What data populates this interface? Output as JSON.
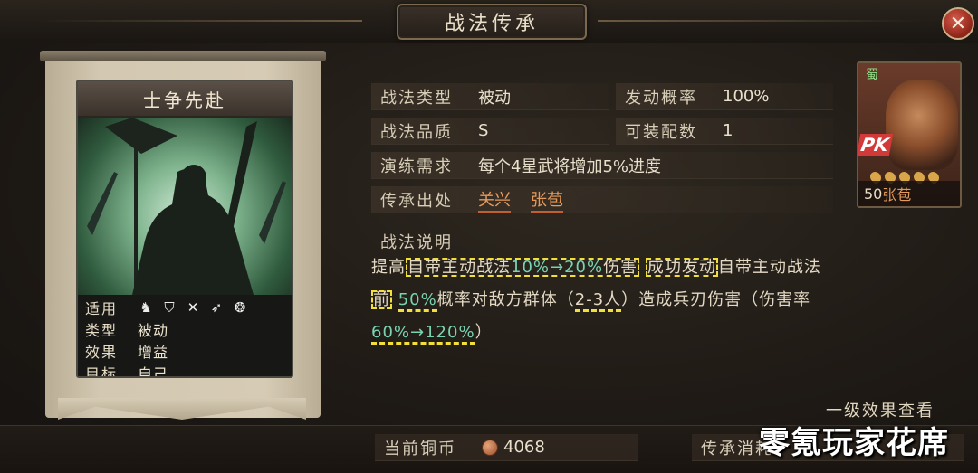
{
  "window": {
    "title": "战法传承",
    "close_label": "✕"
  },
  "card": {
    "name": "士争先赴",
    "stats": [
      {
        "label": "适用",
        "value": ""
      },
      {
        "label": "类型",
        "value": "被动"
      },
      {
        "label": "效果",
        "value": "增益"
      },
      {
        "label": "目标",
        "value": "自己"
      }
    ],
    "troop_icons": [
      "cavalry-icon",
      "shield-icon",
      "bow-icon",
      "spear-icon",
      "wheel-icon"
    ]
  },
  "info": {
    "type_label": "战法类型",
    "type_value": "被动",
    "rate_label": "发动概率",
    "rate_value": "100%",
    "quality_label": "战法品质",
    "quality_value": "S",
    "equip_label": "可装配数",
    "equip_value": "1",
    "practice_label": "演练需求",
    "practice_value": "每个4星武将增加5%进度",
    "source_label": "传承出处",
    "source_1": "关兴",
    "source_2": "张苞"
  },
  "description": {
    "title": "战法说明",
    "l1_a": "提高",
    "l1_b": "自带主动战法",
    "l1_c": "10%→20%",
    "l1_d": "伤害",
    "l1_e": "成功发动",
    "l1_f": "自带主动战法",
    "l2_a": "前",
    "l2_b": "50%",
    "l2_c": "概率对敌方群体（",
    "l2_d": "2-3人",
    "l2_e": "）造成兵刃伤害（伤害率",
    "l3_a": "60%→120%",
    "l3_b": "）"
  },
  "level_link": "一级效果查看",
  "general": {
    "faction": "蜀",
    "badge": "PK",
    "level": "50",
    "name": "张苞"
  },
  "footer": {
    "copper_label": "当前铜币",
    "copper_value": "4068",
    "cost_label": "传承消耗"
  },
  "watermark": "零氪玩家花席",
  "colors": {
    "accent_green": "#7ad3b0",
    "link_orange": "#e59a5b",
    "annotation_yellow": "#f3df3a"
  }
}
